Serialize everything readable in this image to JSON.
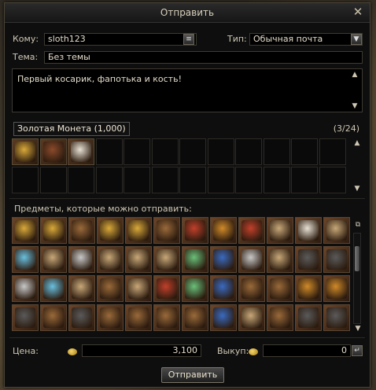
{
  "window": {
    "title": "Отправить"
  },
  "form": {
    "to_label": "Кому:",
    "to_value": "sloth123",
    "type_label": "Тип:",
    "type_value": "Обычная почта",
    "subject_label": "Тема:",
    "subject_value": "Без темы",
    "message": "Первый косарик, фапотька и кость!"
  },
  "attachments": {
    "tooltip": "Золотая Монета (1,000)",
    "count": "(3/24)",
    "items": [
      "gold-coin-icon",
      "helmet-icon",
      "bone-icon"
    ]
  },
  "available": {
    "label": "Предметы, которые можно отправить:",
    "items": [
      "gold-pile-icon",
      "gold-coin-icon",
      "vase-icon",
      "coin-icon",
      "skull-coin-icon",
      "amulet-icon",
      "red-potion-icon",
      "amber-potion-icon",
      "red-flask-icon",
      "scroll-icon",
      "bone-icon",
      "leather-icon",
      "diamond-icon",
      "map-icon",
      "cloth-icon",
      "pink-scroll-icon",
      "tablet-icon",
      "parchment-icon",
      "green-gem-stick-icon",
      "blue-gem-stick-icon",
      "metal-mesh-icon",
      "rope-icon",
      "coal-icon",
      "black-ore-icon",
      "powder-icon",
      "crystal-ball-icon",
      "rope-coil-icon",
      "chest-icon",
      "leather-piece-icon",
      "red-crystal-icon",
      "green-crystal-icon",
      "globe-icon",
      "box-icon",
      "nuts-icon",
      "amber-gem-icon",
      "orange-gem-icon",
      "robe-icon",
      "sack-icon",
      "bolt-icon",
      "chest-piece-icon",
      "cone-icon",
      "cone-icon",
      "cone-icon",
      "blue-book-icon",
      "fabric-icon",
      "chest-icon",
      "grey-cone-icon",
      "grey-cone-icon",
      "grey-cone-icon",
      "grey-cone-icon",
      "mithril-icon"
    ]
  },
  "footer": {
    "price_label": "Цена:",
    "price_value": "3,100",
    "redemption_label": "Выкуп:",
    "redemption_value": "0",
    "send_label": "Отправить"
  },
  "colors": {
    "window_bg": "#0e0e0e",
    "field_bg": "#000000",
    "accent": "#e8e0cc"
  }
}
